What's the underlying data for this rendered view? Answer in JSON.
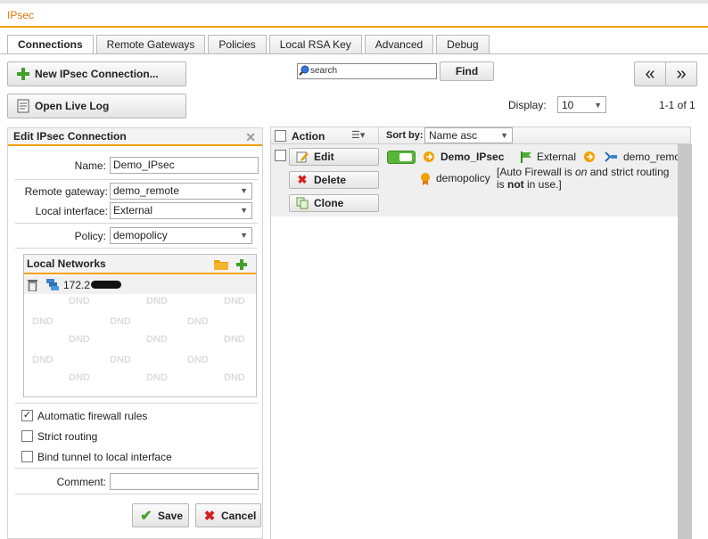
{
  "app": {
    "title": "IPsec"
  },
  "tabs": [
    "Connections",
    "Remote Gateways",
    "Policies",
    "Local RSA Key",
    "Advanced",
    "Debug"
  ],
  "toolbar": {
    "new_connection": "New IPsec Connection...",
    "open_live_log": "Open Live Log",
    "search_placeholder": "search",
    "find": "Find",
    "nav_first": "«",
    "nav_last": "»",
    "display_label": "Display:",
    "display_value": "10",
    "range": "1-1 of 1"
  },
  "edit": {
    "title": "Edit IPsec Connection",
    "name_label": "Name:",
    "name_value": "Demo_IPsec",
    "gateway_label": "Remote gateway:",
    "gateway_value": "demo_remote",
    "interface_label": "Local interface:",
    "interface_value": "External",
    "policy_label": "Policy:",
    "policy_value": "demopolicy",
    "local_networks_title": "Local Networks",
    "network_item": "172.2",
    "dnd_label": "DND",
    "auto_fw_label": "Automatic firewall rules",
    "auto_fw_checked": true,
    "strict_label": "Strict routing",
    "bind_label": "Bind tunnel to local interface",
    "comment_label": "Comment:",
    "comment_value": "",
    "save": "Save",
    "cancel": "Cancel"
  },
  "list": {
    "action_header": "Action",
    "sort_label": "Sort by:",
    "sort_value": "Name asc",
    "row": {
      "edit": "Edit",
      "delete": "Delete",
      "clone": "Clone",
      "name": "Demo_IPsec",
      "interface": "External",
      "gateway": "demo_remo",
      "policy": "demopolicy",
      "note_pre": "[Auto Firewall is ",
      "note_on": "on",
      "note_mid": " and strict routing is",
      "note_not": "not",
      "note_post": " in use.]"
    }
  },
  "colors": {
    "accent": "#f0a000",
    "title": "#e2760e",
    "enabled": "#5ab63a"
  }
}
